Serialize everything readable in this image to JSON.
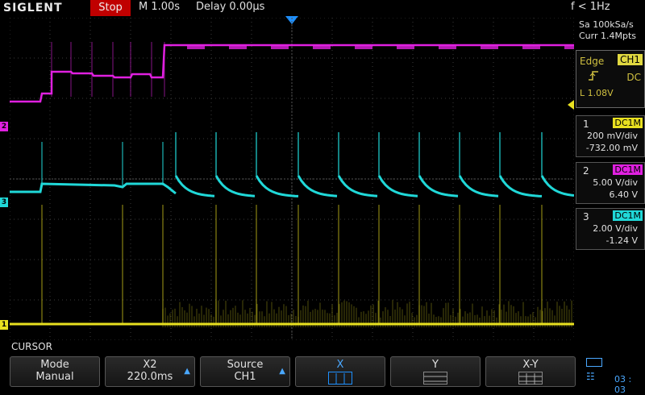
{
  "brand": "SIGLENT",
  "status": {
    "run_state": "Stop",
    "timebase": "M 1.00s",
    "delay": "Delay 0.00µs",
    "frequency": "f < 1Hz"
  },
  "acquisition": {
    "sample_rate": "Sa 100kSa/s",
    "memory_depth": "Curr 1.4Mpts"
  },
  "trigger": {
    "type": "Edge",
    "source": "CH1",
    "slope_icon": "rising-edge-icon",
    "coupling": "DC",
    "level": "L 1.08V"
  },
  "channels": [
    {
      "num": "1",
      "coupling": "DC1M",
      "scale": "200 mV/div",
      "offset": "-732.00 mV",
      "color": "#e8e020"
    },
    {
      "num": "2",
      "coupling": "DC1M",
      "scale": "5.00 V/div",
      "offset": "6.40 V",
      "color": "#e020e0"
    },
    {
      "num": "3",
      "coupling": "DC1M",
      "scale": "2.00 V/div",
      "offset": "-1.24 V",
      "color": "#20d8d8"
    }
  ],
  "channel_markers": [
    "2",
    "3",
    "1"
  ],
  "menu": {
    "title": "CURSOR",
    "items": [
      {
        "top": "Mode",
        "bottom": "Manual"
      },
      {
        "top": "X2",
        "bottom": "220.0ms"
      },
      {
        "top": "Source",
        "bottom": "CH1"
      },
      {
        "top": "X",
        "bottom": ""
      },
      {
        "top": "Y",
        "bottom": ""
      },
      {
        "top": "X-Y",
        "bottom": ""
      }
    ]
  },
  "clock": "03 : 03"
}
